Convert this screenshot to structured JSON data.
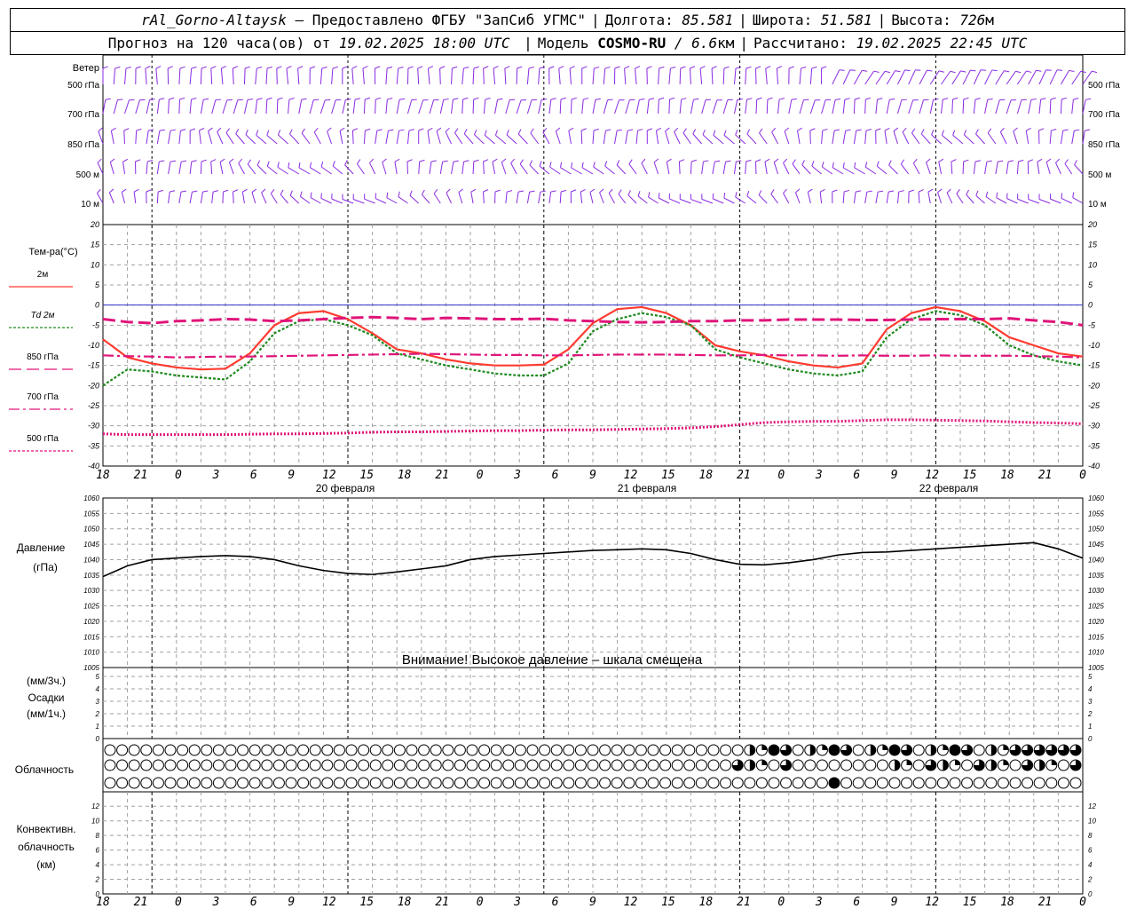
{
  "header": {
    "station": "rAl_Gorno-Altaysk",
    "provider": "– Предоставлено ФГБУ \"ЗапСиб УГМС\"",
    "lon_label": "Долгота:",
    "lon": "85.581",
    "lat_label": "Широта:",
    "lat": "51.581",
    "alt_label": "Высота:",
    "alt": "726",
    "alt_unit": "м",
    "forecast_prefix": "Прогноз на 120 часа(ов) от",
    "forecast_from": "19.02.2025 18:00 UTC",
    "model_label": "Модель",
    "model": "COSMO-RU",
    "model_res": "/ 6.6",
    "model_res_unit": "км",
    "calc_label": "Рассчитано:",
    "calc_time": "19.02.2025 22:45 UTC"
  },
  "notice": "Внимание! Высокое давление – шкала смещена",
  "time_axis": {
    "hour_labels": [
      "18",
      "21",
      "0",
      "3",
      "6",
      "9",
      "12",
      "15",
      "18",
      "21",
      "0",
      "3",
      "6",
      "9",
      "12",
      "15",
      "18",
      "21",
      "0",
      "3",
      "6",
      "9",
      "12",
      "15",
      "18",
      "21",
      "0"
    ],
    "day_labels": [
      "20 февраля",
      "21 февраля",
      "22 февраля"
    ]
  },
  "colors": {
    "wind": "#8a2be2",
    "t2m": "#ff3b30",
    "td2m": "#1e8a1e",
    "t850": "#e0147a",
    "t700": "#e0147a",
    "t500": "#e0147a",
    "zero_line": "#3333cc",
    "pressure": "#000000",
    "grid": "#a0a0a0"
  },
  "chart_data": [
    {
      "type": "wind_barbs",
      "ylabel": "Ветер",
      "levels": [
        "500 гПа",
        "700 гПа",
        "850 гПа",
        "500 м",
        "10 м"
      ]
    },
    {
      "type": "line",
      "ylabel": "Тем-ра(°C)",
      "ylim": [
        -40,
        20
      ],
      "y_ticks": [
        20,
        15,
        10,
        5,
        0,
        -5,
        -10,
        -15,
        -20,
        -25,
        -30,
        -35,
        -40
      ],
      "x": [
        0,
        3,
        6,
        9,
        12,
        15,
        18,
        21,
        24,
        27,
        30,
        33,
        36,
        39,
        42,
        45,
        48,
        51,
        54,
        57,
        60,
        63,
        66,
        69,
        72,
        75,
        78,
        81,
        84,
        87,
        90,
        93,
        96,
        99,
        102,
        105,
        108,
        111,
        114,
        117,
        120
      ],
      "series": [
        {
          "name": "2м",
          "style": "solid",
          "values": [
            -8.5,
            -13,
            -14.5,
            -15.5,
            -16,
            -15.8,
            -12,
            -5,
            -2,
            -1.5,
            -3.5,
            -7,
            -11,
            -12,
            -13.5,
            -14.5,
            -15,
            -15,
            -14.8,
            -11,
            -4.5,
            -1,
            -0.5,
            -2,
            -5,
            -10,
            -11.5,
            -12.5,
            -14,
            -15,
            -15.5,
            -14.5,
            -6,
            -2,
            -0.5,
            -1.5,
            -4,
            -8,
            -10,
            -12,
            -12.8
          ]
        },
        {
          "name": "Td 2м",
          "style": "dotted",
          "values": [
            -20,
            -16,
            -16.5,
            -17.5,
            -18,
            -18.5,
            -14,
            -7,
            -4,
            -3.5,
            -5,
            -7.5,
            -12,
            -13.5,
            -15,
            -16,
            -17,
            -17.5,
            -17.5,
            -14.5,
            -6.5,
            -3.5,
            -2,
            -3,
            -5,
            -11,
            -13,
            -14.5,
            -16,
            -17,
            -17.5,
            -16.5,
            -8,
            -3.5,
            -1.5,
            -2.5,
            -5,
            -10,
            -12.5,
            -14,
            -15
          ]
        },
        {
          "name": "850 гПа",
          "style": "dash",
          "values": [
            -3.5,
            -4.2,
            -4.5,
            -4,
            -3.8,
            -3.5,
            -3.6,
            -4,
            -3.8,
            -3.5,
            -3.2,
            -3,
            -3.2,
            -3.5,
            -3.2,
            -3.3,
            -3.5,
            -3.5,
            -3.4,
            -3.8,
            -4,
            -4.2,
            -4.3,
            -4.2,
            -4,
            -4,
            -3.8,
            -3.8,
            -3.6,
            -3.6,
            -3.6,
            -3.7,
            -3.7,
            -3.6,
            -3.5,
            -3.5,
            -3.5,
            -3.3,
            -3.8,
            -4.2,
            -5
          ]
        },
        {
          "name": "700 гПа",
          "style": "dashdot",
          "values": [
            -12.5,
            -12.7,
            -12.8,
            -13,
            -12.9,
            -12.8,
            -12.8,
            -12.7,
            -12.6,
            -12.5,
            -12.4,
            -12.3,
            -12.2,
            -12.1,
            -12.2,
            -12.3,
            -12.4,
            -12.4,
            -12.5,
            -12.5,
            -12.4,
            -12.3,
            -12.3,
            -12.3,
            -12.4,
            -12.5,
            -12.5,
            -12.4,
            -12.5,
            -12.5,
            -12.6,
            -12.5,
            -12.6,
            -12.6,
            -12.5,
            -12.6,
            -12.6,
            -12.6,
            -12.7,
            -12.8,
            -13
          ]
        },
        {
          "name": "500 гПа",
          "style": "dotted",
          "values": [
            -32,
            -32.2,
            -32.2,
            -32.2,
            -32.2,
            -32.2,
            -32.1,
            -32,
            -32,
            -31.9,
            -31.8,
            -31.6,
            -31.5,
            -31.5,
            -31.4,
            -31.3,
            -31.2,
            -31.2,
            -31.1,
            -31,
            -31,
            -30.9,
            -30.8,
            -30.7,
            -30.5,
            -30.2,
            -29.7,
            -29.2,
            -29,
            -28.9,
            -28.9,
            -28.7,
            -28.5,
            -28.5,
            -28.6,
            -28.7,
            -28.8,
            -29,
            -29.2,
            -29.3,
            -29.5
          ]
        }
      ]
    },
    {
      "type": "line",
      "ylabel": "Давление",
      "yunit": "(гПа)",
      "ylim": [
        1005,
        1060
      ],
      "y_ticks": [
        1060,
        1055,
        1050,
        1045,
        1040,
        1035,
        1030,
        1025,
        1020,
        1015,
        1010,
        1005
      ],
      "x": [
        0,
        3,
        6,
        9,
        12,
        15,
        18,
        21,
        24,
        27,
        30,
        33,
        36,
        39,
        42,
        45,
        48,
        51,
        54,
        57,
        60,
        63,
        66,
        69,
        72,
        75,
        78,
        81,
        84,
        87,
        90,
        93,
        96,
        99,
        102,
        105,
        108,
        111,
        114,
        117,
        120
      ],
      "series": [
        {
          "name": "",
          "values": [
            1034.5,
            1038,
            1040,
            1040.5,
            1041,
            1041.3,
            1041,
            1040,
            1038,
            1036.5,
            1035.5,
            1035.2,
            1036,
            1037,
            1038,
            1040,
            1041,
            1041.5,
            1042,
            1042.5,
            1043,
            1043.2,
            1043.5,
            1043.2,
            1042,
            1040,
            1038.5,
            1038.3,
            1039,
            1040,
            1041.5,
            1042.3,
            1042.5,
            1043,
            1043.5,
            1044,
            1044.5,
            1045,
            1045.5,
            1043.5,
            1040.5
          ]
        }
      ]
    },
    {
      "type": "bar",
      "ylabel": "(мм/3ч.)",
      "ylabel2": "Осадки",
      "ylabel3": "(мм/1ч.)",
      "ylim": [
        0,
        5
      ],
      "y_ticks": [
        5,
        4,
        3,
        2,
        1,
        0
      ],
      "values": []
    },
    {
      "type": "cloud_cover",
      "ylabel": "Облачность",
      "rows": 3
    },
    {
      "type": "bar",
      "ylabel": "Конвективн.",
      "ylabel2": "облачность",
      "ylabel3": "(км)",
      "ylim": [
        0,
        13
      ],
      "y_ticks": [
        12,
        10,
        8,
        6,
        4,
        2,
        0
      ],
      "values": []
    }
  ]
}
